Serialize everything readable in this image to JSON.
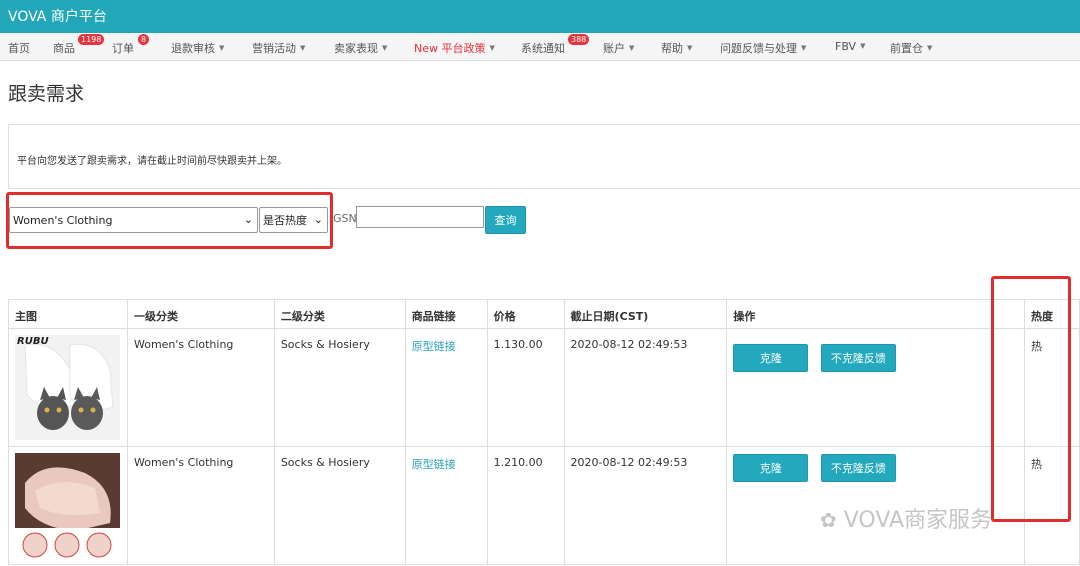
{
  "app": {
    "title": "VOVA 商户平台"
  },
  "nav": {
    "items": [
      {
        "label": "首页"
      },
      {
        "label": "商品",
        "badge": "1198"
      },
      {
        "label": "订单",
        "badge": "8"
      },
      {
        "label": "退款审核"
      },
      {
        "label": "营销活动"
      },
      {
        "label": "卖家表现"
      },
      {
        "label": "New 平台政策"
      },
      {
        "label": "系统通知",
        "badge": "388"
      },
      {
        "label": "账户"
      },
      {
        "label": "帮助"
      },
      {
        "label": "问题反馈与处理"
      },
      {
        "label": "FBV"
      },
      {
        "label": "前置仓"
      }
    ]
  },
  "page": {
    "title": "跟卖需求",
    "notice": "平台向您发送了跟卖需求，请在截止时间前尽快跟卖并上架。"
  },
  "filters": {
    "category_value": "Women's Clothing",
    "hot_value": "是否热度",
    "gsn_label": "GSN:",
    "gsn_value": "",
    "search_label": "查询"
  },
  "table": {
    "headers": [
      "主图",
      "一级分类",
      "二级分类",
      "商品链接",
      "价格",
      "截止日期(CST)",
      "操作",
      "热度"
    ],
    "rows": [
      {
        "image_text": "RUBU",
        "category1": "Women's Clothing",
        "category2": "Socks & Hosiery",
        "link": "原型链接",
        "price": "1.130.00",
        "deadline": "2020-08-12 02:49:53",
        "clone_label": "克隆",
        "feedback_label": "不克隆反馈",
        "hot": "热"
      },
      {
        "image_text": "",
        "category1": "Women's Clothing",
        "category2": "Socks & Hosiery",
        "link": "原型链接",
        "price": "1.210.00",
        "deadline": "2020-08-12 02:49:53",
        "clone_label": "克隆",
        "feedback_label": "不克隆反馈",
        "hot": "热"
      }
    ]
  },
  "watermark": "VOVA商家服务",
  "colors": {
    "brand": "#21a7b8",
    "button": "#23a8bd",
    "highlight": "#e22d2d",
    "badge": "#e8323c"
  }
}
